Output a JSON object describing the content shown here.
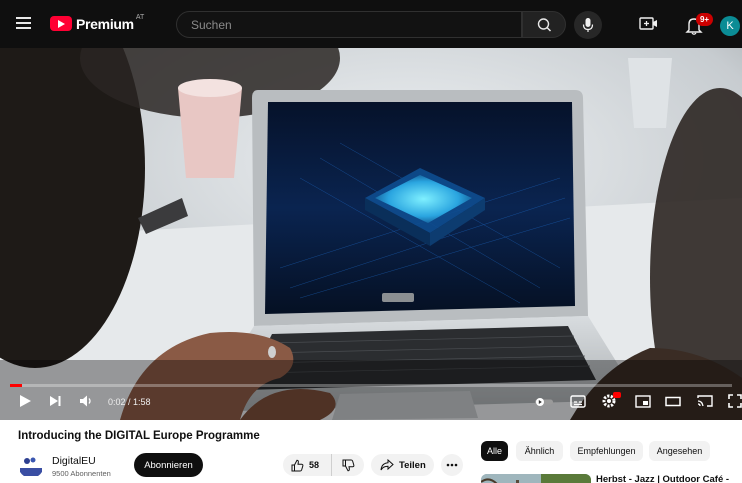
{
  "header": {
    "logo_text": "Premium",
    "logo_region": "AT",
    "search_placeholder": "Suchen",
    "notification_count": "9+",
    "avatar_letter": "K"
  },
  "player": {
    "time_display": "0:02 / 1:58",
    "progress_fraction": 0.017
  },
  "video": {
    "title": "Introducing the DIGITAL Europe Programme",
    "channel_name": "DigitalEU",
    "subscribers": "9500 Abonnenten",
    "subscribe_label": "Abonnieren",
    "like_count": "58",
    "share_label": "Teilen"
  },
  "chips": [
    {
      "label": "Alle",
      "active": true
    },
    {
      "label": "Ähnlich",
      "active": false
    },
    {
      "label": "Empfehlungen",
      "active": false
    },
    {
      "label": "Angesehen",
      "active": false
    }
  ],
  "recommendation": {
    "title": "Herbst - Jazz | Outdoor Café -"
  },
  "colors": {
    "accent": "#ff0033",
    "topbar_bg": "#0f0f0f",
    "progress": "#ff0000",
    "avatar": "#0b8c95"
  },
  "icons": [
    "menu-icon",
    "youtube-logo-icon",
    "search-icon",
    "microphone-icon",
    "create-icon",
    "bell-icon",
    "play-icon",
    "next-icon",
    "volume-icon",
    "autoplay-toggle-icon",
    "subtitles-icon",
    "settings-icon",
    "miniplayer-icon",
    "theater-icon",
    "cast-icon",
    "fullscreen-icon",
    "thumbs-up-icon",
    "thumbs-down-icon",
    "share-icon",
    "more-icon"
  ]
}
